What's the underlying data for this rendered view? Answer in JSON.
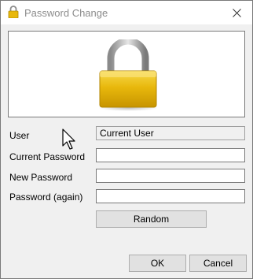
{
  "window": {
    "title": "Password Change",
    "close_glyph": "✕"
  },
  "form": {
    "user": {
      "label": "User",
      "value": "Current User"
    },
    "current_password": {
      "label": "Current Password",
      "value": ""
    },
    "new_password": {
      "label": "New Password",
      "value": ""
    },
    "password_again": {
      "label": "Password (again)",
      "value": ""
    }
  },
  "buttons": {
    "random": "Random",
    "ok": "OK",
    "cancel": "Cancel"
  },
  "icons": {
    "title": "padlock-icon",
    "banner": "padlock-image",
    "cursor": "mouse-pointer"
  },
  "colors": {
    "lock_gold": "#e8b80c",
    "shackle_silver": "#b8b8b8",
    "window_bg": "#f0f0f0"
  }
}
